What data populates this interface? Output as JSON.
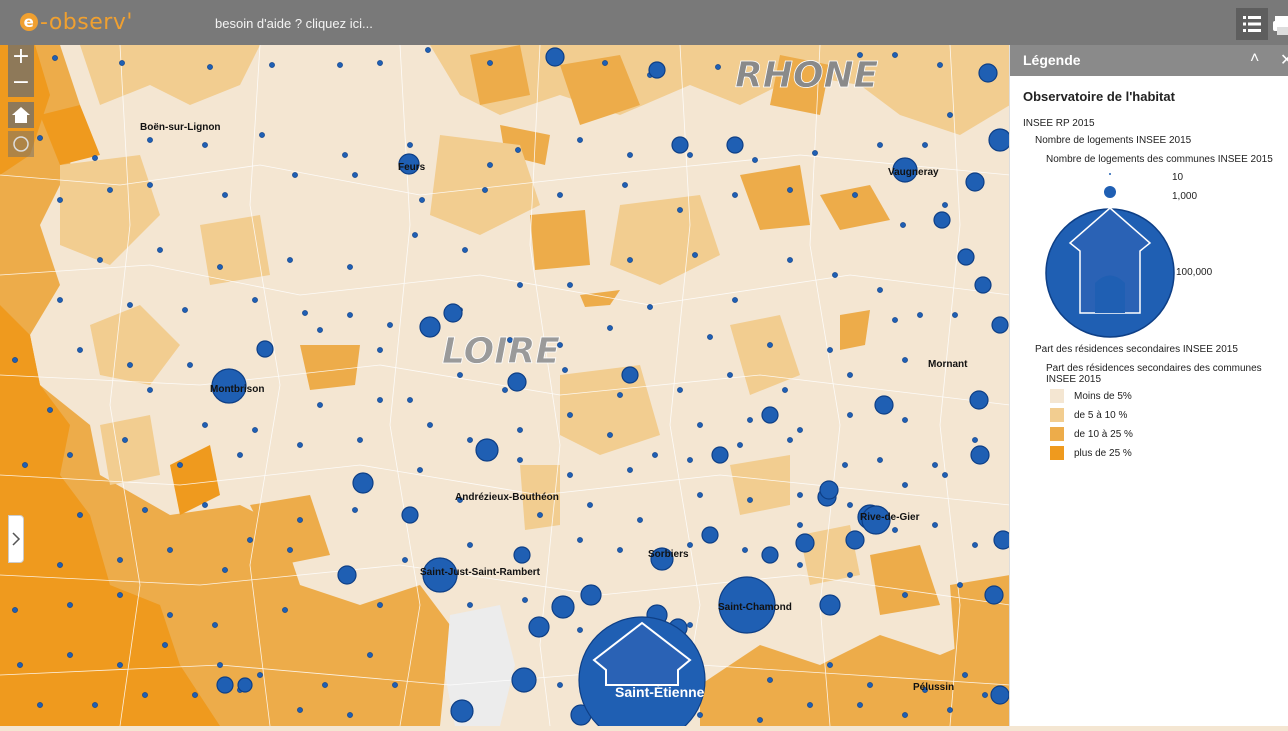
{
  "app": {
    "logo_text": "e-observ'",
    "logo_prefix": "e",
    "logo_suffix": "-observ'",
    "help_link": "besoin d'aide ? cliquez ici..."
  },
  "toolbar": {
    "layers_icon": "list-icon",
    "print_icon": "printer-icon"
  },
  "map_controls": {
    "zoom_in": "+",
    "zoom_out": "−",
    "home_icon": "home-icon",
    "locate_icon": "locate-icon",
    "panel_toggle_icon": "chevron-right-icon"
  },
  "map": {
    "regions": [
      {
        "name": "RHONE"
      },
      {
        "name": "LOIRE"
      }
    ],
    "places": [
      "Boën-sur-Lignon",
      "Feurs",
      "Vaugneray",
      "Montbrison",
      "Mornant",
      "Andrézieux-Bouthéon",
      "Rive-de-Gier",
      "Sorbiers",
      "Saint-Just-Saint-Rambert",
      "Saint-Chamond",
      "Saint-Étienne",
      "Pélussin"
    ],
    "colors": {
      "class1": "#f4e6d2",
      "class2": "#f2cd90",
      "class3": "#edac4a",
      "class4": "#ef9a1e",
      "symbol_fill": "#1f5fb3",
      "symbol_outline": "#0e3f86"
    }
  },
  "legend": {
    "title": "Légende",
    "collapse_icon": "chevron-up-double-icon",
    "close_icon": "close-icon",
    "heading": "Observatoire de l'habitat",
    "source": "INSEE RP 2015",
    "layer1": {
      "title": "Nombre de logements INSEE 2015",
      "subtitle": "Nombre de logements des communes INSEE 2015",
      "sizes": [
        "10",
        "1,000",
        "100,000"
      ]
    },
    "layer2": {
      "title": "Part des résidences secondaires INSEE 2015",
      "subtitle_line1": "Part des résidences secondaires des communes",
      "subtitle_line2": "INSEE 2015",
      "classes": [
        {
          "label": "Moins de 5%",
          "color": "#f4e6d2"
        },
        {
          "label": "de 5 à 10 %",
          "color": "#f2cd90"
        },
        {
          "label": "de 10 à 25 %",
          "color": "#edac4a"
        },
        {
          "label": "plus de 25 %",
          "color": "#ef9a1e"
        }
      ]
    }
  }
}
